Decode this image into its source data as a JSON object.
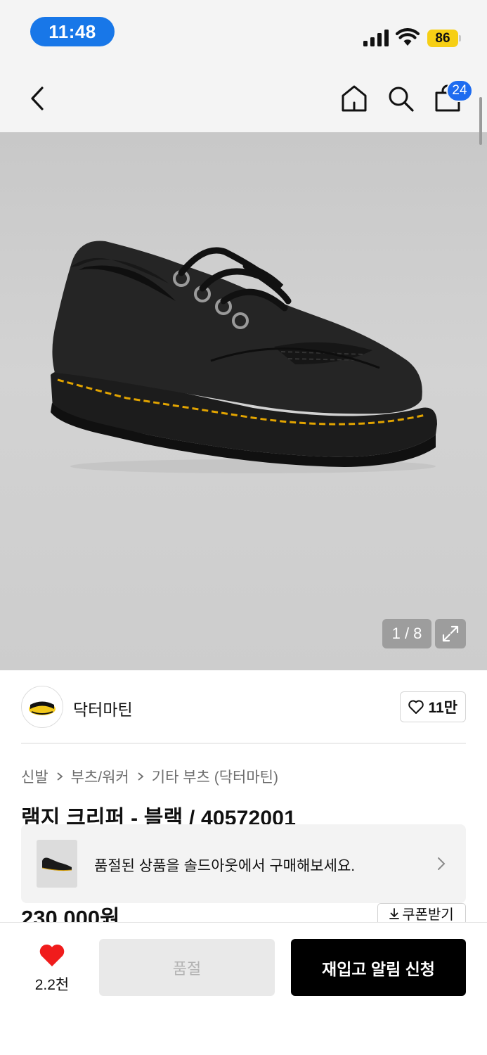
{
  "status_bar": {
    "time": "11:48",
    "battery": "86"
  },
  "nav": {
    "cart_count": "24"
  },
  "gallery": {
    "counter": "1 / 8",
    "current_index": 1,
    "total_images": 8
  },
  "brand": {
    "name": "닥터마틴",
    "likes": "11만"
  },
  "breadcrumb": [
    "신발",
    "부츠/워커",
    "기타 부츠 (닥터마틴)"
  ],
  "product": {
    "title": "램지 크리퍼 - 블랙 / 40572001",
    "price": "230,000원"
  },
  "soldout_banner": {
    "text": "품절된 상품을 솔드아웃에서 구매해보세요."
  },
  "coupon": {
    "label": "쿠폰받기"
  },
  "bottom_bar": {
    "wish_count": "2.2천",
    "soldout_label": "품절",
    "restock_label": "재입고 알림 신청"
  },
  "colors": {
    "accent_blue": "#1e6cf0",
    "time_pill": "#1877e8",
    "battery": "#f6cf15",
    "heart_red": "#f01c1c",
    "primary_button": "#000000"
  }
}
